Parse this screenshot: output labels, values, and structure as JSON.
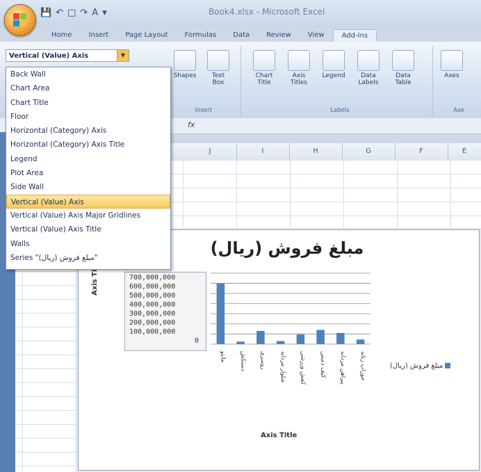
{
  "window": {
    "title": "Book4.xlsx - Microsoft Excel"
  },
  "ribbon": {
    "tabs": [
      "Home",
      "Insert",
      "Page Layout",
      "Formulas",
      "Data",
      "Review",
      "View",
      "Add-Ins"
    ],
    "selection_combo": "Vertical (Value) Axis",
    "insert_group": {
      "label": "Insert",
      "buttons": [
        "Shapes",
        "Text Box"
      ]
    },
    "labels_group": {
      "label": "Labels",
      "buttons": [
        "Chart Title",
        "Axis Titles",
        "Legend",
        "Data Labels",
        "Data Table"
      ]
    },
    "axes_group": {
      "label": "Axe",
      "buttons": [
        "Axes"
      ]
    }
  },
  "formula_bar": {
    "fx": "fx"
  },
  "columns": [
    "J",
    "I",
    "H",
    "G",
    "F",
    "E"
  ],
  "dropdown": {
    "items": [
      "Back Wall",
      "Chart Area",
      "Chart Title",
      "Floor",
      "Horizontal (Category) Axis",
      "Horizontal (Category) Axis Title",
      "Legend",
      "Plot Area",
      "Side Wall",
      "Vertical (Value) Axis",
      "Vertical (Value) Axis Major Gridlines",
      "Vertical (Value) Axis Title",
      "Walls",
      "Series \"مبلغ فروش (ریال)\""
    ],
    "selected_index": 9
  },
  "chart_data": {
    "type": "bar",
    "title": "مبلغ فروش (ریال)",
    "xlabel": "Axis Title",
    "ylabel": "Axis Title",
    "yticks": [
      "700,000,000",
      "600,000,000",
      "500,000,000",
      "400,000,000",
      "300,000,000",
      "200,000,000",
      "100,000,000",
      "0"
    ],
    "ylim": [
      0,
      700000000
    ],
    "categories": [
      "جوراب زنانه",
      "پیراهن مردانه",
      "کیف دستی",
      "کفش ورزشی",
      "شلوار مردانه",
      "روسری",
      "دستکش",
      "مانتو"
    ],
    "series": [
      {
        "name": "مبلغ فروش (ریال)",
        "values": [
          45000000,
          110000000,
          140000000,
          95000000,
          30000000,
          130000000,
          25000000,
          600000000
        ],
        "color": "#4f81bd"
      }
    ],
    "legend_position": "right",
    "grid": true
  }
}
